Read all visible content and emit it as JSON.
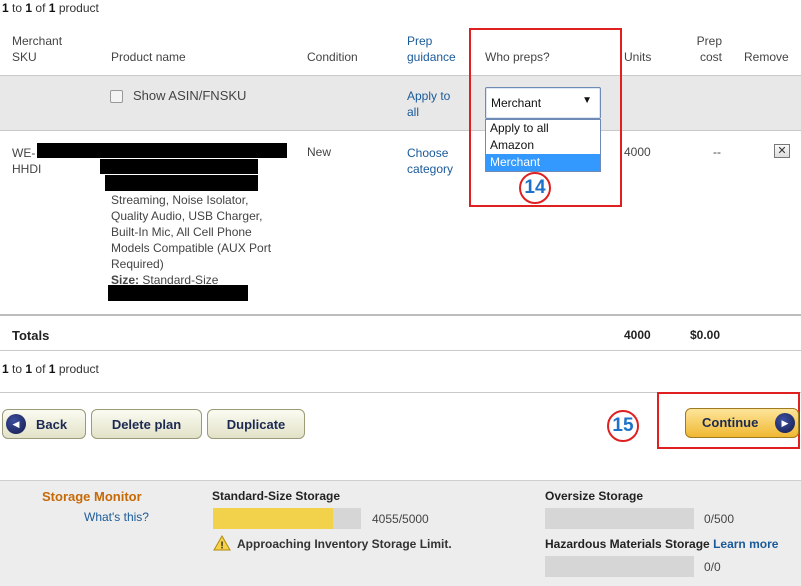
{
  "pager_top": {
    "a": "1",
    "to": "to",
    "b": "1",
    "of": "of",
    "c": "1",
    "word": "product"
  },
  "pager_bottom": {
    "a": "1",
    "to": "to",
    "b": "1",
    "of": "of",
    "c": "1",
    "word": "product"
  },
  "columns": {
    "merchant_sku": [
      "Merchant",
      "SKU"
    ],
    "product_name": "Product name",
    "condition": "Condition",
    "prep_guidance": [
      "Prep",
      "guidance"
    ],
    "who_preps": "Who preps?",
    "units": "Units",
    "prep_cost": [
      "Prep",
      "cost"
    ],
    "remove": "Remove"
  },
  "bulk_row": {
    "show_asin_label": "Show ASIN/FNSKU",
    "apply_to_all": [
      "Apply to",
      "all"
    ],
    "who_preps_value": "Merchant"
  },
  "dropdown_options": [
    "Apply to all",
    "Amazon",
    "Merchant"
  ],
  "product_row": {
    "sku_line1": "WE-",
    "sku_line2": "HHDI",
    "description": [
      "Streaming, Noise Isolator,",
      "Quality Audio, USB Charger,",
      "Built-In Mic, All Cell Phone",
      "Models Compatible (AUX Port",
      "Required)"
    ],
    "size_label": "Size:",
    "size_value": "Standard-Size",
    "condition": "New",
    "prep_guidance": [
      "Choose",
      "category"
    ],
    "units": "4000",
    "prep_cost": "--",
    "remove_glyph": "✕"
  },
  "totals": {
    "label": "Totals",
    "units": "4000",
    "cost": "$0.00"
  },
  "annotations": {
    "step14": "14",
    "step15": "15"
  },
  "buttons": {
    "back": "Back",
    "delete": "Delete plan",
    "duplicate": "Duplicate",
    "continue": "Continue"
  },
  "storage": {
    "title": "Storage Monitor",
    "whats_this": "What's this?",
    "standard_label": "Standard-Size Storage",
    "standard_value": "4055/5000",
    "standard_fraction": 0.811,
    "warning": "Approaching Inventory Storage Limit.",
    "oversize_label": "Oversize Storage",
    "oversize_value": "0/500",
    "hazmat_label": "Hazardous Materials Storage",
    "learn_more": "Learn more",
    "hazmat_value": "0/0"
  },
  "colors": {
    "accent_red": "#e02020",
    "link_blue": "#1a5a99",
    "bar_yellow": "#f2d24a"
  }
}
